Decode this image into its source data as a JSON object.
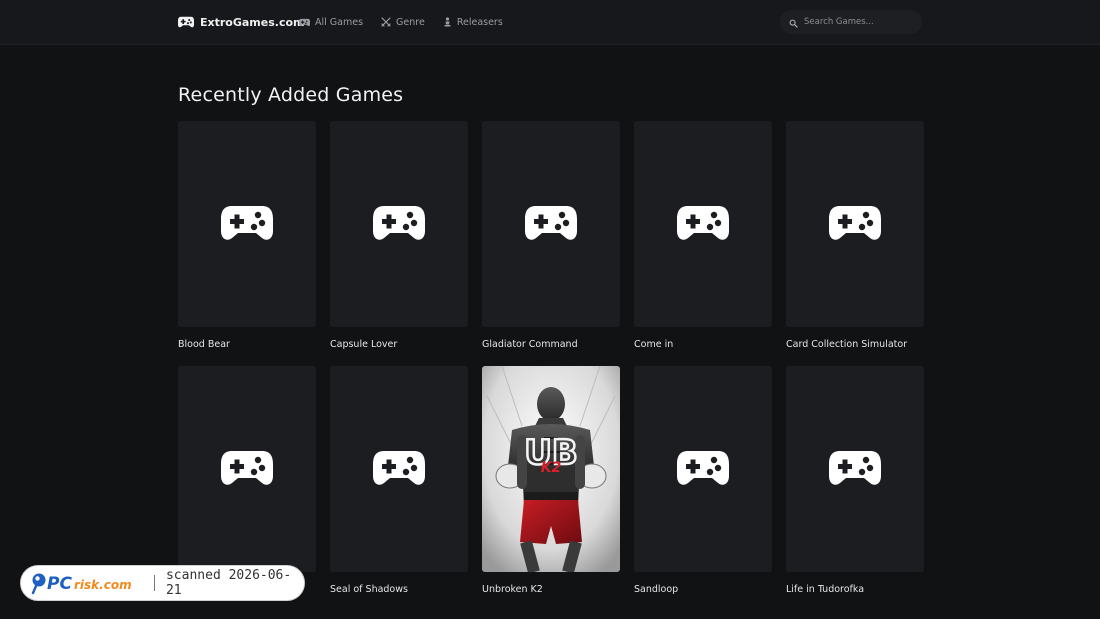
{
  "header": {
    "brand": "ExtroGames.com",
    "nav": [
      {
        "label": "All Games",
        "icon": "gamepad-icon"
      },
      {
        "label": "Genre",
        "icon": "swords-icon"
      },
      {
        "label": "Releasers",
        "icon": "chess-pawn-icon"
      }
    ],
    "search_placeholder": "Search Games..."
  },
  "main": {
    "title": "Recently Added Games",
    "games": [
      {
        "title": "Blood Bear",
        "cover": "placeholder"
      },
      {
        "title": "Capsule Lover",
        "cover": "placeholder"
      },
      {
        "title": "Gladiator Command",
        "cover": "placeholder"
      },
      {
        "title": "Come in",
        "cover": "placeholder"
      },
      {
        "title": "Card Collection Simulator",
        "cover": "placeholder"
      },
      {
        "title": "",
        "cover": "placeholder"
      },
      {
        "title": "Seal of Shadows",
        "cover": "placeholder"
      },
      {
        "title": "Unbroken K2",
        "cover": "boxer-artwork"
      },
      {
        "title": "Sandloop",
        "cover": "placeholder"
      },
      {
        "title": "Life in Tudorofka",
        "cover": "placeholder"
      }
    ]
  },
  "watermark": {
    "logo": "PCrisk.com",
    "text": "scanned 2026-06-21"
  },
  "colors": {
    "background": "#111214",
    "topbar": "#17181b",
    "card": "#1c1d21",
    "accent_blue": "#1f5fbf",
    "accent_orange": "#f08a1c"
  }
}
